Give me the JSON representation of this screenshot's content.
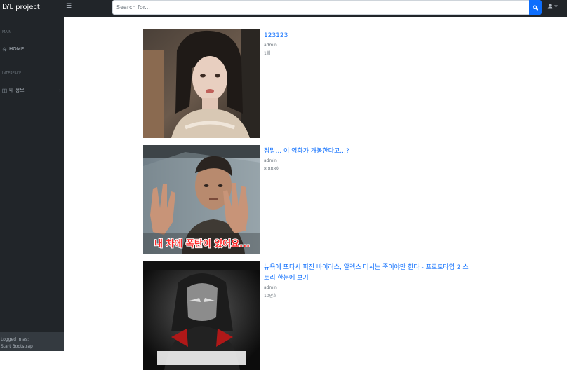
{
  "app": {
    "brand": "LYL project"
  },
  "search": {
    "placeholder": "Search for..."
  },
  "sidebar": {
    "sections": [
      {
        "heading": "MAIN",
        "items": [
          {
            "label": "HOME",
            "icon": "home-icon"
          }
        ]
      },
      {
        "heading": "INTERFACE",
        "items": [
          {
            "label": "내 정보",
            "icon": "columns-icon"
          }
        ]
      }
    ],
    "footer": {
      "logged_in_label": "Logged in as:",
      "user": "Start Bootstrap"
    }
  },
  "videos": [
    {
      "title": "123123",
      "author": "admin",
      "views": "1회"
    },
    {
      "title": "정말... 이 영화가 개봉한다고...?",
      "author": "admin",
      "views": "8,888회",
      "thumbnail_caption": "내 차에 폭탄이 있어요..."
    },
    {
      "title": "뉴욕에 또다시 퍼진 바이러스, 알렉스 머서는 죽어야만 한다 - 프로토타입 2 스토리 한눈에 보기",
      "author": "admin",
      "views": "10만회"
    }
  ],
  "colors": {
    "dark_nav": "#212529",
    "accent": "#0d6efd",
    "muted": "#6c757d"
  }
}
